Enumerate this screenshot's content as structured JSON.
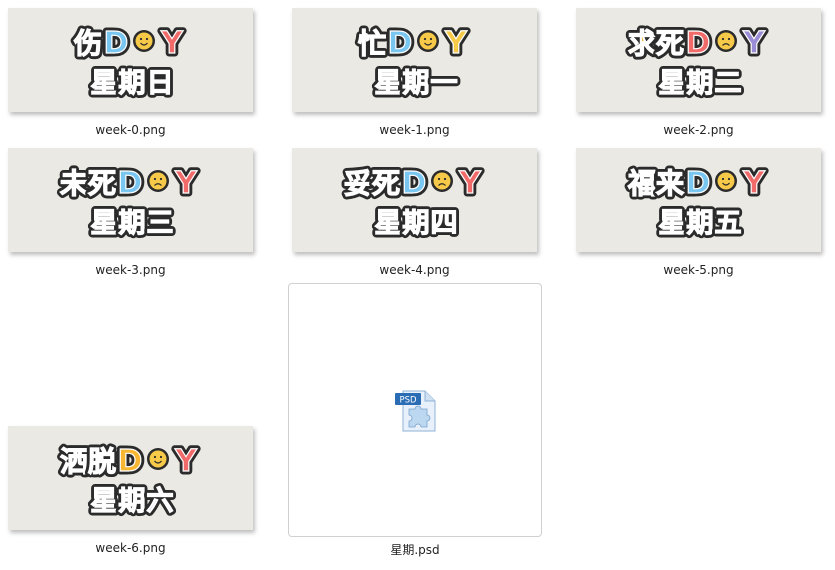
{
  "files": [
    {
      "name": "week-0.png",
      "line1": "伤",
      "line2": "星期日",
      "mood": "happy",
      "colors": [
        "#f7b733",
        "#f26b6b",
        "#79c6f0",
        "#6bc3a4"
      ]
    },
    {
      "name": "week-1.png",
      "line1": "忙",
      "line2": "星期一",
      "mood": "happy",
      "colors": [
        "#f26b6b",
        "#f7c948",
        "#79c6f0",
        "#2d2d2d"
      ]
    },
    {
      "name": "week-2.png",
      "line1": "求死",
      "line2": "星期二",
      "mood": "sad",
      "colors": [
        "#f7b733",
        "#9b8cd6",
        "#f26b6b",
        "#f26b6b"
      ]
    },
    {
      "name": "week-3.png",
      "line1": "未死",
      "line2": "星期三",
      "mood": "sad",
      "colors": [
        "#6bc3a4",
        "#f26b6b",
        "#79c6f0",
        "#9b8cd6"
      ]
    },
    {
      "name": "week-4.png",
      "line1": "妥死",
      "line2": "星期四",
      "mood": "sad",
      "colors": [
        "#9b8cd6",
        "#f26b6b",
        "#79c6f0",
        "#f26b6b"
      ]
    },
    {
      "name": "week-5.png",
      "line1": "福来",
      "line2": "星期五",
      "mood": "happy",
      "colors": [
        "#6bc3a4",
        "#f26b6b",
        "#79c6f0",
        "#f7b733"
      ]
    },
    {
      "name": "week-6.png",
      "line1": "洒脱",
      "line2": "星期六",
      "mood": "happy",
      "colors": [
        "#79c6f0",
        "#f26b6b",
        "#f7b733",
        "#9b8cd6"
      ]
    }
  ],
  "psd_file": {
    "name": "星期.psd",
    "icon_label": "PSD",
    "icon": "psd-file-icon"
  }
}
